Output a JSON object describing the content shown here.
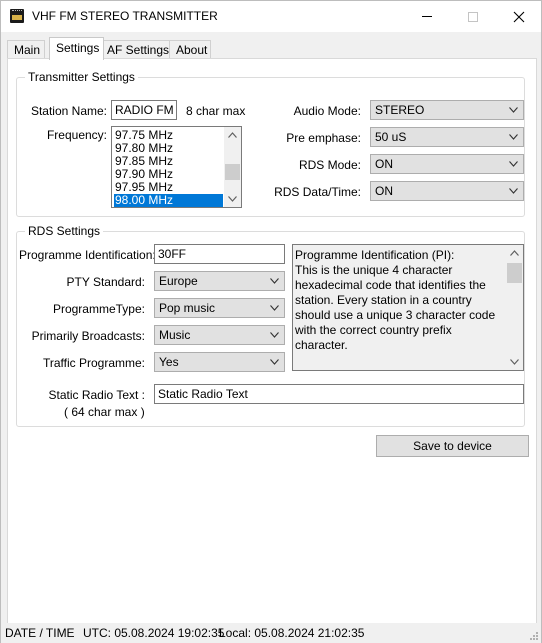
{
  "window": {
    "title": "VHF FM STEREO TRANSMITTER"
  },
  "tabs": [
    {
      "label": "Main"
    },
    {
      "label": "Settings"
    },
    {
      "label": "AF Settings"
    },
    {
      "label": "About"
    }
  ],
  "transmitter": {
    "title": "Transmitter Settings",
    "station_name_label": "Station Name:",
    "station_name_value": "RADIO FM",
    "station_name_hint": "8 char max",
    "frequency_label": "Frequency:",
    "frequencies": [
      "97.75 MHz",
      "97.80 MHz",
      "97.85 MHz",
      "97.90 MHz",
      "97.95 MHz",
      "98.00 MHz"
    ],
    "frequency_selected": "98.00 MHz",
    "audio_mode_label": "Audio Mode:",
    "audio_mode_value": "STEREO",
    "pre_emphase_label": "Pre emphase:",
    "pre_emphase_value": "50 uS",
    "rds_mode_label": "RDS Mode:",
    "rds_mode_value": "ON",
    "rds_datetime_label": "RDS Data/Time:",
    "rds_datetime_value": "ON"
  },
  "rds": {
    "title": "RDS Settings",
    "pi_label": "Programme Identification:",
    "pi_value": "30FF",
    "pty_standard_label": "PTY Standard:",
    "pty_standard_value": "Europe",
    "programme_type_label": "ProgrammeType:",
    "programme_type_value": "Pop music",
    "primarily_broadcasts_label": "Primarily Broadcasts:",
    "primarily_broadcasts_value": "Music",
    "traffic_programme_label": "Traffic Programme:",
    "traffic_programme_value": "Yes",
    "info_text": "Programme Identification (PI):\nThis is the unique 4 character hexadecimal code that identifies the station. Every station in a country should use a unique 3 character code with the correct country prefix character.\n\nPTY Standard:",
    "static_text_label": "Static Radio Text :",
    "static_text_hint": "( 64 char max )",
    "static_text_value": "Static Radio Text"
  },
  "save_button_label": "Save to device",
  "status": {
    "label": "DATE / TIME",
    "utc": "UTC: 05.08.2024 19:02:35",
    "local": "Local: 05.08.2024 21:02:35"
  },
  "colors": {
    "selection": "#0078d7",
    "window_bg": "#f0f0f0",
    "panel_bg": "#ffffff"
  }
}
